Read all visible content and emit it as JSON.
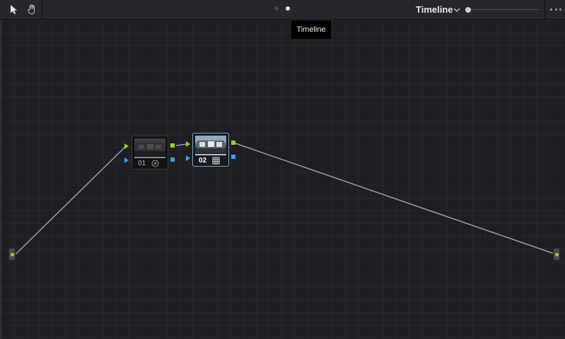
{
  "toolbar": {
    "tools": [
      {
        "name": "pointer-tool",
        "icon": "arrow-pointer-icon"
      },
      {
        "name": "hand-tool",
        "icon": "hand-icon"
      }
    ],
    "pages": [
      {
        "state": "inactive"
      },
      {
        "state": "active"
      }
    ],
    "mode_title": "Timeline",
    "mode_chevron_icon": "chevron-down-icon",
    "zoom_level": 0,
    "more_icon": "more-horizontal-icon"
  },
  "tooltip": {
    "text": "Timeline"
  },
  "node_graph": {
    "input": {
      "port_color": "#9bd317"
    },
    "output": {
      "port_color": "#9bd317"
    },
    "nodes": [
      {
        "label": "01",
        "icon": "fx-icon",
        "selected": false
      },
      {
        "label": "02",
        "icon": "grid-icon",
        "selected": true
      }
    ],
    "colors": {
      "rgb_port": "#9bd317",
      "alpha_port": "#2aa6e8",
      "link": "#9c9ca3",
      "selection": "#6aa6d6"
    }
  }
}
